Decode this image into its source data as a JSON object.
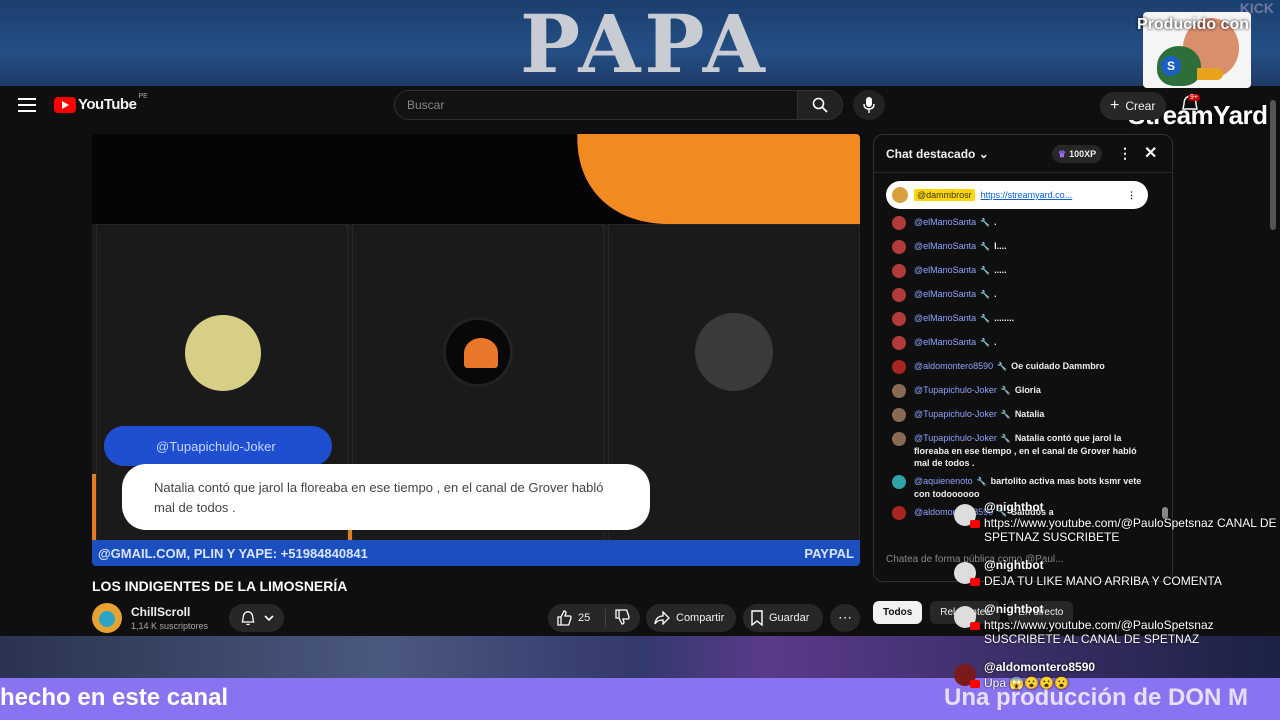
{
  "overlay": {
    "top_title": "PAPA",
    "kick_text": "KICK",
    "producido": "Producido con",
    "streamyard_a": "Stream",
    "streamyard_b": "Yard",
    "bottom_left": "hecho en este canal",
    "bottom_right": "Una producción de DON M"
  },
  "header": {
    "logo_text": "YouTube",
    "logo_country": "PE",
    "search_placeholder": "Buscar",
    "create_label": "Crear",
    "notif_badge": "9+"
  },
  "video": {
    "name_pill": "@Tupapichulo-Joker",
    "bubble_text": "Natalia contó que jarol la floreaba en ese tiempo , en el canal de Grover habló mal de todos .",
    "band_left": "@GMAIL.COM, PLIN Y YAPE: +51984840841",
    "band_right": "PAYPAL",
    "title": "LOS INDIGENTES DE LA LIMOSNERÍA",
    "channel_name": "ChillScroll",
    "channel_subs": "1,14 K suscriptores",
    "likes": "25",
    "share_label": "Compartir",
    "save_label": "Guardar"
  },
  "chat": {
    "header_title": "Chat destacado",
    "xp_label": "100XP",
    "pinned_name": "@dammbrosr",
    "pinned_link": "https://streamyard.co...",
    "messages": [
      {
        "name": "@elManoSanta",
        "text": "."
      },
      {
        "name": "@elManoSanta",
        "text": "l...."
      },
      {
        "name": "@elManoSanta",
        "text": "....."
      },
      {
        "name": "@elManoSanta",
        "text": "."
      },
      {
        "name": "@elManoSanta",
        "text": "........"
      },
      {
        "name": "@elManoSanta",
        "text": "."
      },
      {
        "name": "@aldomontero8590",
        "text": "Oe cuidado Dammbro"
      },
      {
        "name": "@Tupapichulo-Joker",
        "text": "Gloria"
      },
      {
        "name": "@Tupapichulo-Joker",
        "text": "Natalia"
      },
      {
        "name": "@Tupapichulo-Joker",
        "text": "Natalia contó que jarol la floreaba en ese tiempo , en el canal de Grover habló mal de todos ."
      },
      {
        "name": "@aquienenoto",
        "text": "bartolito activa mas bots ksmr vete con todoooooo"
      },
      {
        "name": "@aldomontero8590",
        "text": "Saludos a"
      }
    ],
    "input_placeholder": "Chatea de forma pública como @Paul...",
    "tabs": [
      "Todos",
      "Relevantes",
      "En directo"
    ]
  },
  "overlay_comments": [
    {
      "name": "@nightbot",
      "text": "https://www.youtube.com/@PauloSpetsnaz CANAL DE SPETNAZ SUSCRIBETE"
    },
    {
      "name": "@nightbot",
      "text": "DEJA TU LIKE MANO ARRIBA Y COMENTA"
    },
    {
      "name": "@nightbot",
      "text": "https://www.youtube.com/@PauloSpetsnaz SUSCRIBETE AL CANAL DE SPETNAZ"
    },
    {
      "name": "@aldomontero8590",
      "text": "Upa 😱😮😮😮"
    }
  ]
}
